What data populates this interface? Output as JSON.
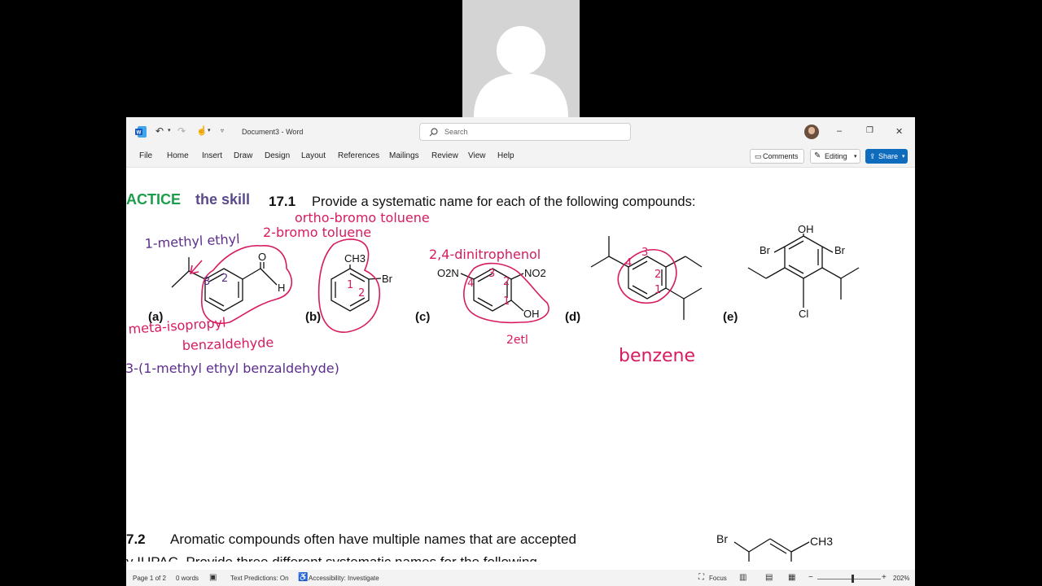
{
  "title_bar": {
    "document_title": "Document3",
    "app_name": "Word",
    "separator": "-",
    "search_placeholder": "Search",
    "minimize": "–",
    "restore": "❐",
    "close": "✕"
  },
  "ribbon": {
    "tabs": [
      "File",
      "Home",
      "Insert",
      "Draw",
      "Design",
      "Layout",
      "References",
      "Mailings",
      "Review",
      "View",
      "Help"
    ],
    "comments_label": "Comments",
    "editing_label": "Editing",
    "share_label": "Share"
  },
  "document": {
    "heading_prefix": "ACTICE",
    "heading_skill": "the skill",
    "problem_number": "17.1",
    "problem_text": "Provide a systematic name for each of the following compounds:",
    "labels": [
      "(a)",
      "(b)",
      "(c)",
      "(d)",
      "(e)"
    ],
    "atoms": {
      "a_o": "O",
      "a_h": "H",
      "b_ch3": "CH3",
      "b_br": "Br",
      "c_o2n": "O2N",
      "c_no2": "NO2",
      "c_oh": "OH",
      "e_oh": "OH",
      "e_br1": "Br",
      "e_br2": "Br",
      "e_cl": "Cl"
    },
    "annotations": {
      "a1": "1-methyl ethyl",
      "a2": "meta-isopropyl",
      "a3": "benzaldehyde",
      "a4": "3-(1-methyl ethyl benzaldehyde)",
      "b1": "ortho-bromo toluene",
      "b2": "2-bromo toluene",
      "c1": "2,4-dinitrophenol",
      "c2": "2etl",
      "d1": "benzene",
      "num_3a": "3",
      "num_2a": "2",
      "num_1b": "1",
      "num_2b": "2",
      "num_4c": "4",
      "num_3c": "3",
      "num_2c": "2",
      "num_1c": "1",
      "num_3d": "3",
      "num_4d": "4",
      "num_2d": "2",
      "num_1d": "1"
    },
    "problem2_number": "7.2",
    "problem2_text": "Aromatic compounds often have multiple names that are accepted",
    "problem2_text2": "y IUPAC. Provide three different systematic names for the following",
    "p2_br": "Br",
    "p2_ch3": "CH3"
  },
  "status_bar": {
    "page": "Page 1 of 2",
    "words": "0 words",
    "text_predictions": "Text Predictions: On",
    "accessibility": "Accessibility: Investigate",
    "focus": "Focus",
    "zoom": "202%",
    "zoom_level": 0.56
  },
  "colors": {
    "accent_green": "#1b9e4b",
    "skill_purple": "#5b4a8a",
    "ink_pink": "#d81b60",
    "ink_purple": "#5b2d8c",
    "share_blue": "#0f6cbd"
  }
}
